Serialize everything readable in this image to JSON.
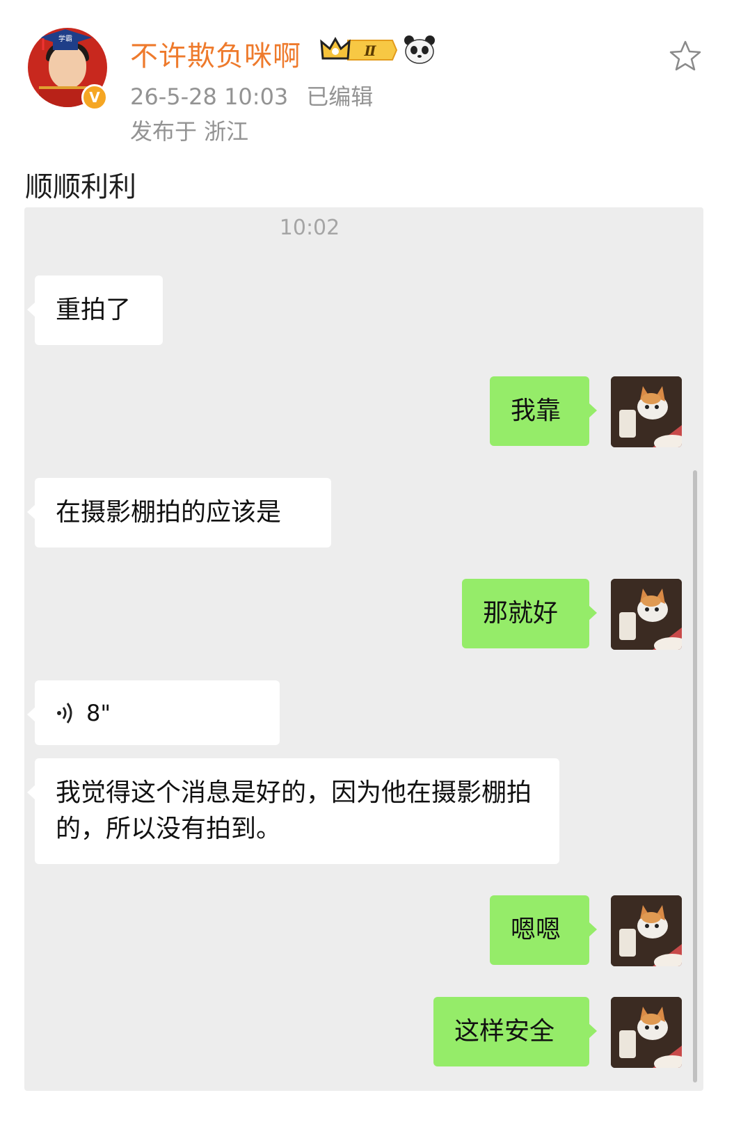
{
  "post": {
    "username": "不许欺负咪啊",
    "vip_level": "Ⅱ",
    "timestamp": "26-5-28 10:03",
    "edited": "已编辑",
    "location": "发布于 浙江",
    "text": "顺顺利利",
    "avatar_cap_text": "学霸",
    "colors": {
      "username": "#ee7a2c",
      "verified": "#f5a623",
      "meta": "#939393"
    }
  },
  "chat": {
    "time": "10:02",
    "colors": {
      "background": "#ededed",
      "incoming": "#ffffff",
      "outgoing": "#95ec69"
    },
    "messages": [
      {
        "side": "in",
        "text": "重拍了"
      },
      {
        "side": "out",
        "text": "我靠"
      },
      {
        "side": "in",
        "text": "在摄影棚拍的应该是"
      },
      {
        "side": "out",
        "text": "那就好"
      },
      {
        "side": "in",
        "type": "voice",
        "duration": "8\""
      },
      {
        "side": "in",
        "text": "我觉得这个消息是好的，因为他在摄影棚拍的，所以没有拍到。"
      },
      {
        "side": "out",
        "text": "嗯嗯"
      },
      {
        "side": "out",
        "text": "这样安全"
      }
    ]
  }
}
